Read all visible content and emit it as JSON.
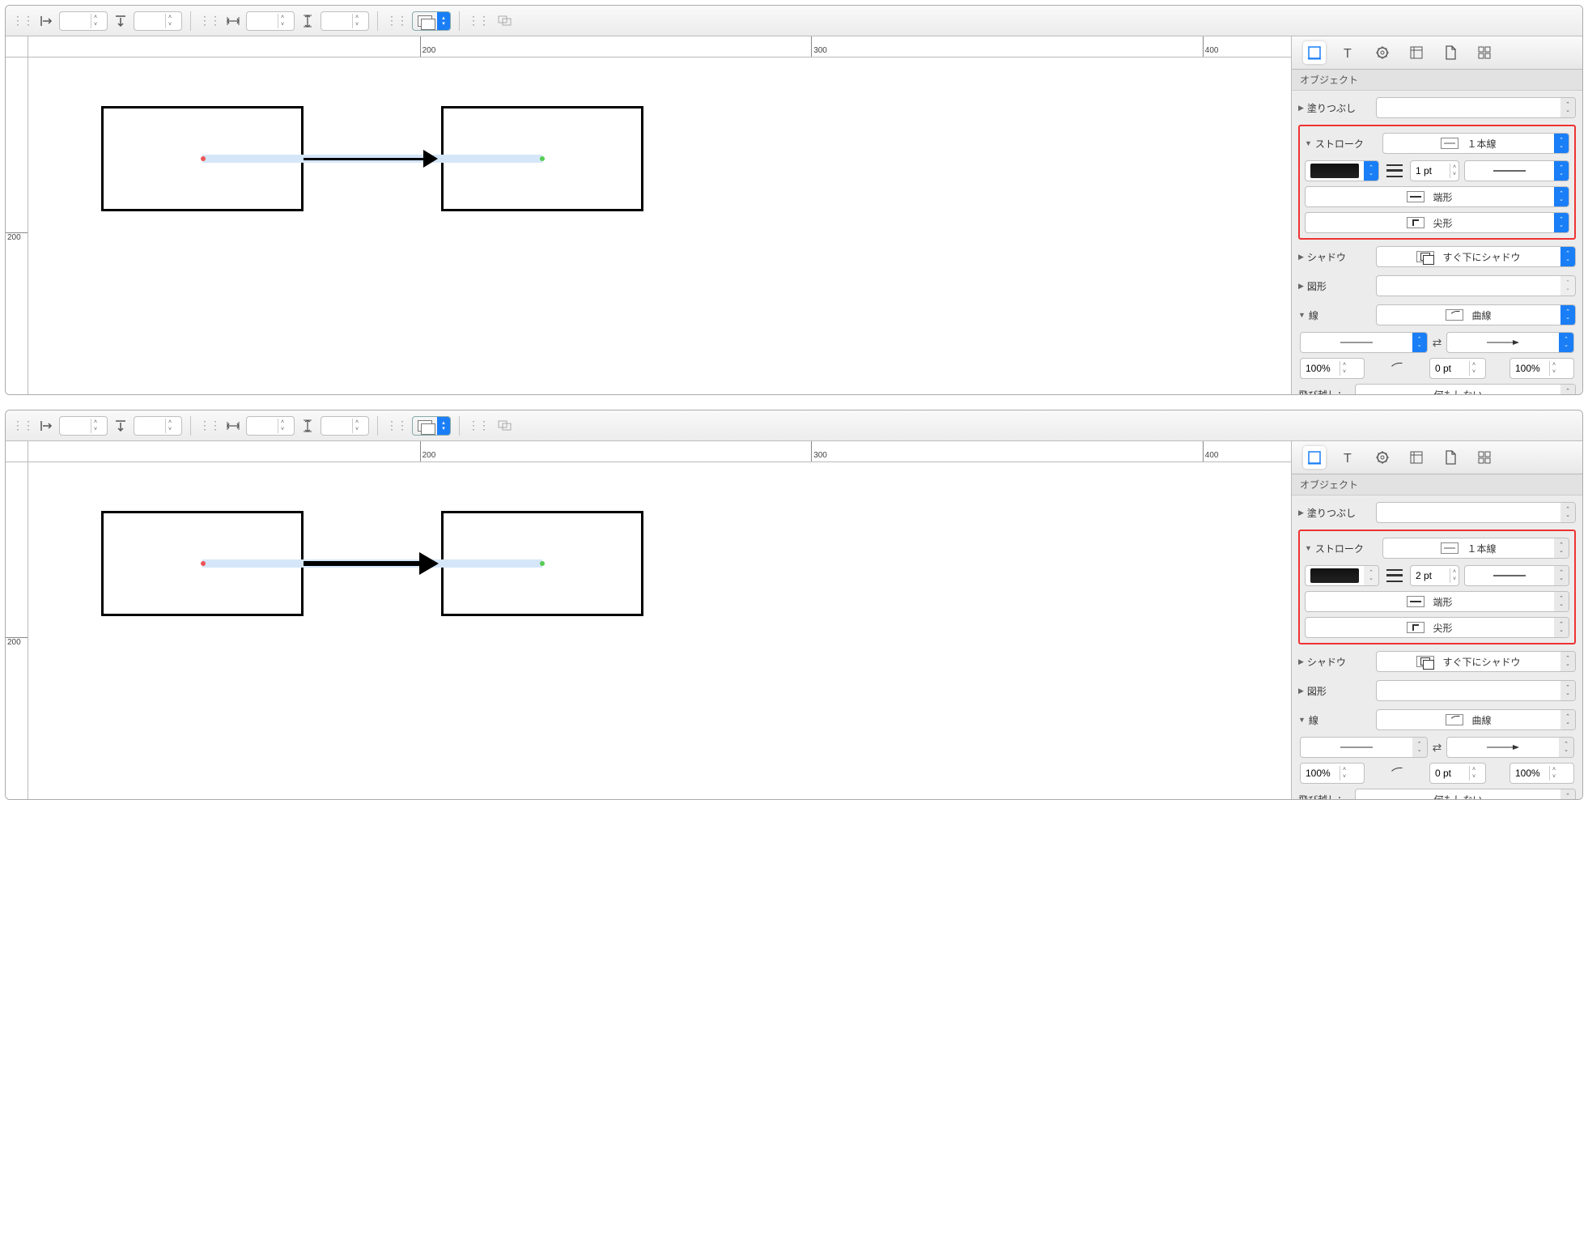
{
  "ruler": {
    "v_tick": "200",
    "h_tick_200": "200",
    "h_tick_300": "300",
    "h_tick_400": "400"
  },
  "inspector": {
    "title": "オブジェクト",
    "fill_label": "塗りつぶし",
    "stroke_label": "ストローク",
    "stroke_type": "１本線",
    "cap_label": "端形",
    "corner_label": "尖形",
    "shadow_label": "シャドウ",
    "shadow_value": "すぐ下にシャドウ",
    "shape_label": "図形",
    "line_label": "線",
    "line_value": "曲線",
    "hop_label": "飛び越し：",
    "hop_value": "何もしない",
    "percent_left": "100%",
    "percent_right": "100%",
    "offset": "0 pt"
  },
  "panel1": {
    "stroke_width": "1 pt"
  },
  "panel2": {
    "stroke_width": "2 pt"
  }
}
